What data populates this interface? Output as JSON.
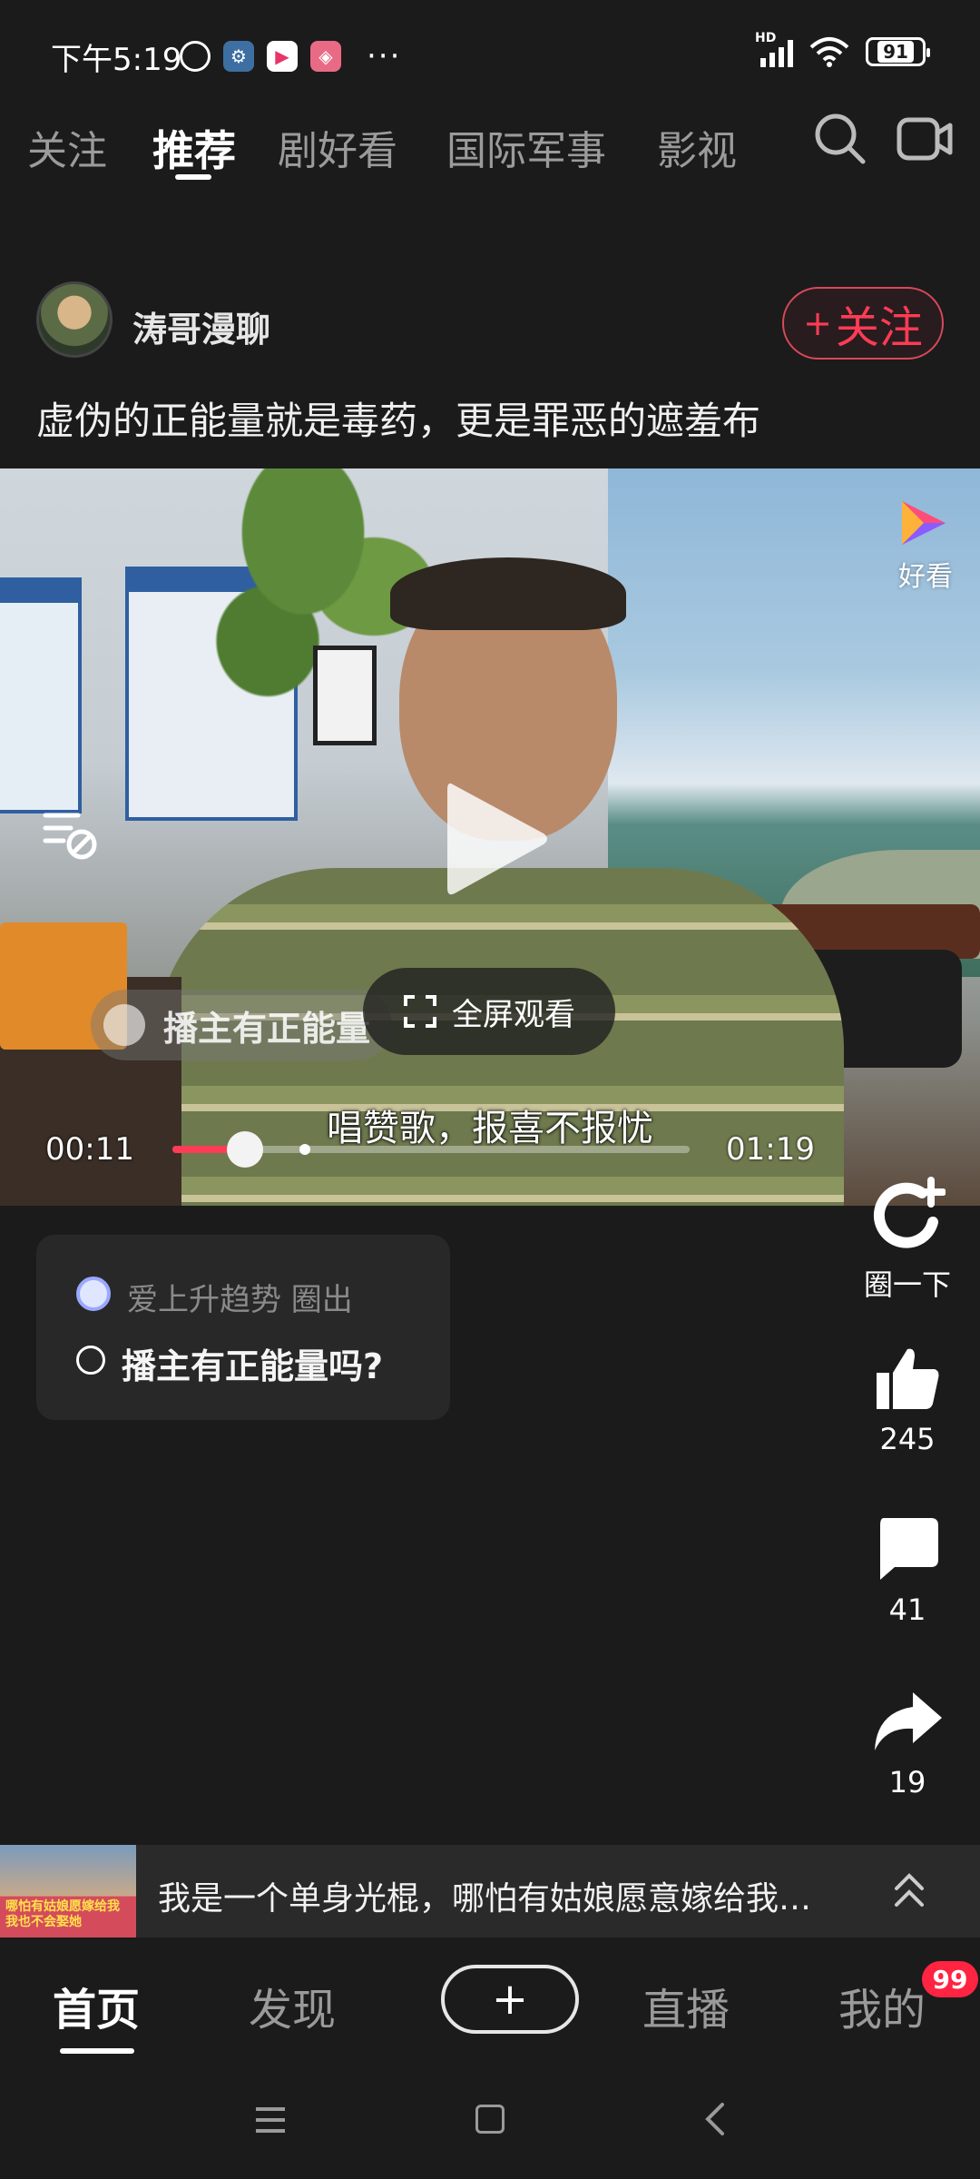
{
  "status_bar": {
    "time": "下午5:19",
    "more": "···",
    "battery": "91",
    "network": "HD"
  },
  "top_tabs": {
    "items": [
      {
        "label": "关注"
      },
      {
        "label": "推荐"
      },
      {
        "label": "剧好看"
      },
      {
        "label": "国际军事"
      },
      {
        "label": "影视"
      }
    ],
    "active_index": 1
  },
  "author": {
    "name": "涛哥漫聊",
    "follow_label": "关注",
    "follow_plus": "+"
  },
  "post": {
    "title": "虚伪的正能量就是毒药，更是罪恶的遮羞布"
  },
  "video": {
    "brand_label": "好看",
    "circle_tag": "播主有正能量",
    "fullscreen_label": "全屏观看",
    "subtitle": "唱赞歌，报喜不报忧",
    "current_time": "00:11",
    "total_time": "01:19",
    "progress": 0.14
  },
  "circle_card": {
    "source": "爱上升趋势 圈出",
    "question": "播主有正能量吗?"
  },
  "actions": {
    "circle_label": "圈一下",
    "likes": "245",
    "comments": "41",
    "shares": "19"
  },
  "recommendation": {
    "text": "我是一个单身光棍，哪怕有姑娘愿意嫁给我，...",
    "thumb_caption_1": "哪怕有姑娘愿嫁给我",
    "thumb_caption_2": "我也不会娶她"
  },
  "bottom_nav": {
    "items": [
      {
        "label": "首页"
      },
      {
        "label": "发现"
      },
      {
        "label": "直播"
      },
      {
        "label": "我的"
      }
    ],
    "add_label": "+",
    "badge": "99"
  },
  "colors": {
    "accent": "#ff3b55",
    "background": "#1b1b1b",
    "badge": "#ff2442"
  },
  "icons": [
    "alarm-icon",
    "gear-icon",
    "play-app-icon",
    "tea-app-icon",
    "signal-icon",
    "wifi-icon",
    "battery-icon",
    "search-icon",
    "camera-icon",
    "brand-logo-icon",
    "danmaku-off-icon",
    "play-icon",
    "fullscreen-icon",
    "circle-plus-icon",
    "thumbs-up-icon",
    "comment-icon",
    "share-icon",
    "chevron-up-icon",
    "menu-icon",
    "home-square-icon",
    "back-icon"
  ]
}
